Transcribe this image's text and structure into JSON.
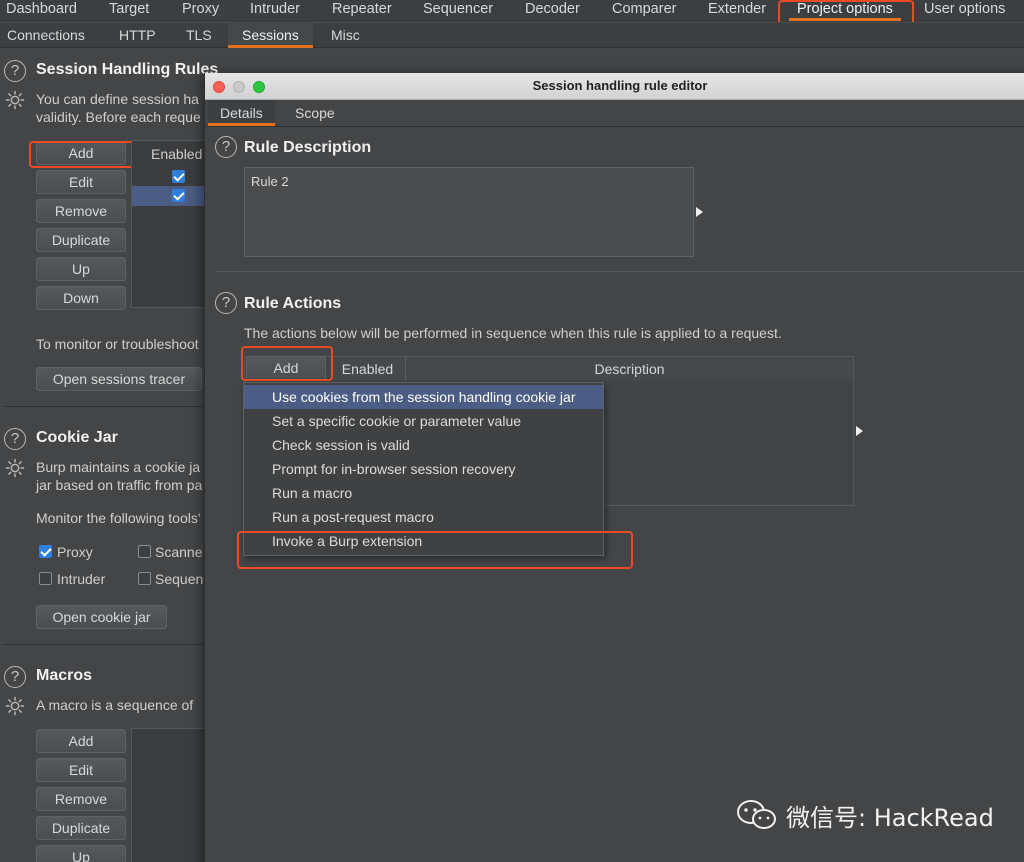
{
  "top_tabs": [
    "Dashboard",
    "Target",
    "Proxy",
    "Intruder",
    "Repeater",
    "Sequencer",
    "Decoder",
    "Comparer",
    "Extender",
    "Project options",
    "User options"
  ],
  "active_top_tab": "Project options",
  "sub_tabs": [
    "Connections",
    "HTTP",
    "TLS",
    "Sessions",
    "Misc"
  ],
  "active_sub_tab": "Sessions",
  "session_rules": {
    "title": "Session Handling Rules",
    "desc_line1": "You can define session ha",
    "desc_line2": "validity. Before each reque",
    "buttons": [
      "Add",
      "Edit",
      "Remove",
      "Duplicate",
      "Up",
      "Down"
    ],
    "table_header": "Enabled",
    "monitor_text": "To monitor or troubleshoot",
    "tracer_button": "Open sessions tracer"
  },
  "cookie_jar": {
    "title": "Cookie Jar",
    "desc_line1": "Burp maintains a cookie ja",
    "desc_line2": "jar based on traffic from pa",
    "monitor_text": "Monitor the following tools'",
    "tools": [
      {
        "label": "Proxy",
        "checked": true
      },
      {
        "label": "Scanne",
        "checked": false
      },
      {
        "label": "Intruder",
        "checked": false
      },
      {
        "label": "Sequen",
        "checked": false
      }
    ],
    "open_button": "Open cookie jar"
  },
  "macros": {
    "title": "Macros",
    "desc": "A macro is a sequence of",
    "buttons": [
      "Add",
      "Edit",
      "Remove",
      "Duplicate",
      "Up"
    ]
  },
  "dialog": {
    "title": "Session handling rule editor",
    "tabs": [
      "Details",
      "Scope"
    ],
    "active_tab": "Details",
    "rule_description": {
      "title": "Rule Description",
      "value": "Rule 2"
    },
    "rule_actions": {
      "title": "Rule Actions",
      "desc": "The actions below will be performed in sequence when this rule is applied to a request.",
      "add_button": "Add",
      "columns": [
        "Enabled",
        "Description"
      ],
      "menu_items": [
        "Use cookies from the session handling cookie jar",
        "Set a specific cookie or parameter value",
        "Check session is valid",
        "Prompt for in-browser session recovery",
        "Run a macro",
        "Run a post-request macro",
        "Invoke a Burp extension"
      ],
      "selected_item": "Use cookies from the session handling cookie jar"
    }
  },
  "watermark": "微信号: HackRead",
  "colors": {
    "accent": "#e0711f",
    "highlight": "#e94c25",
    "menu_selected": "#4b5d84",
    "checkbox": "#2f7ddd"
  }
}
